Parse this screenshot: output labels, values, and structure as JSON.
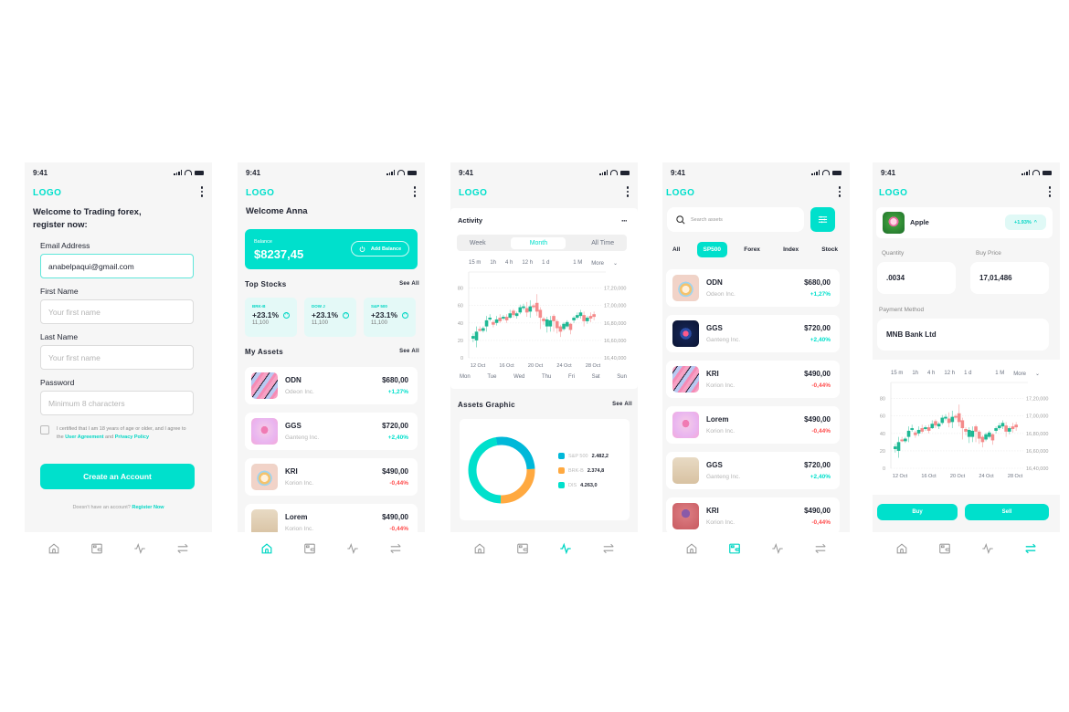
{
  "common": {
    "time": "9:41",
    "logo": "LOGO",
    "nav": [
      "home-icon",
      "wallet-icon",
      "activity-icon",
      "transfer-icon"
    ],
    "colors": {
      "accent": "#00e0cc",
      "negative": "#ff4d4d",
      "orange": "#ffa940",
      "blue": "#00b8d9"
    }
  },
  "register": {
    "title_line1": "Welcome to Trading forex,",
    "title_line2": "register now:",
    "email_label": "Email Address",
    "email_value": "anabelpaqui@gmail.com",
    "first_name_label": "First Name",
    "first_name_placeholder": "Your first name",
    "last_name_label": "Last Name",
    "last_name_placeholder": "Your first name",
    "password_label": "Password",
    "password_placeholder": "Minimum 8 characters",
    "certify_text": "I certified that I am 18 years of age or older, and I agree to the",
    "user_agreement": "User Agreement",
    "and": "and",
    "privacy_policy": "Privacy Policy",
    "create_button": "Create an Account",
    "no_account": "Doesn't have an account?",
    "register_now": "Register Now",
    "active_nav": -1
  },
  "home": {
    "welcome": "Welcome Anna",
    "balance_label": "Balance",
    "balance_value": "$8237,45",
    "add_balance": "Add Balance",
    "top_stocks_title": "Top Stocks",
    "see_all": "See All",
    "top_stocks": [
      {
        "name": "BRK-B",
        "change": "+23.1%",
        "value": "11,100"
      },
      {
        "name": "DOW J",
        "change": "+23.1%",
        "value": "11,100"
      },
      {
        "name": "S&P 500",
        "change": "+23.1%",
        "value": "11,100"
      }
    ],
    "my_assets_title": "My Assets",
    "assets": [
      {
        "ticker": "ODN",
        "company": "Odeon Inc.",
        "price": "$680,00",
        "change": "+1,27%",
        "positive": true,
        "thumb": "stripes"
      },
      {
        "ticker": "GGS",
        "company": "Ganteng Inc.",
        "price": "$720,00",
        "change": "+2,40%",
        "positive": true,
        "thumb": "pink-cloud"
      },
      {
        "ticker": "KRI",
        "company": "Korion Inc.",
        "price": "$490,00",
        "change": "-0,44%",
        "positive": false,
        "thumb": "ball"
      },
      {
        "ticker": "Lorem",
        "company": "Korion Inc.",
        "price": "$490,00",
        "change": "-0,44%",
        "positive": false,
        "thumb": "rolls"
      }
    ]
  },
  "activity": {
    "title": "Activity",
    "segments": [
      "Week",
      "Month",
      "All Time"
    ],
    "active_segment": "Month",
    "timeframes": [
      "15 m",
      "1h",
      "4 h",
      "12 h",
      "1 d",
      "1 M"
    ],
    "more": "More",
    "days": [
      "Mon",
      "Tue",
      "Wed",
      "Thu",
      "Fri",
      "Sat",
      "Sun"
    ],
    "assets_graphic_title": "Assets Graphic",
    "see_all": "See All"
  },
  "market": {
    "search_placeholder": "Search assets",
    "chips": [
      "All",
      "SP500",
      "Forex",
      "Index",
      "Stock"
    ],
    "active_chip": "SP500",
    "assets": [
      {
        "ticker": "ODN",
        "company": "Odeon Inc.",
        "price": "$680,00",
        "change": "+1,27%",
        "positive": true,
        "thumb": "ball"
      },
      {
        "ticker": "GGS",
        "company": "Ganteng Inc.",
        "price": "$720,00",
        "change": "+2,40%",
        "positive": true,
        "thumb": "dark-cube"
      },
      {
        "ticker": "KRI",
        "company": "Korion Inc.",
        "price": "$490,00",
        "change": "-0,44%",
        "positive": false,
        "thumb": "stripes"
      },
      {
        "ticker": "Lorem",
        "company": "Korion Inc.",
        "price": "$490,00",
        "change": "-0,44%",
        "positive": false,
        "thumb": "pink-cloud"
      },
      {
        "ticker": "GGS",
        "company": "Ganteng Inc.",
        "price": "$720,00",
        "change": "+2,40%",
        "positive": true,
        "thumb": "rolls"
      },
      {
        "ticker": "KRI",
        "company": "Korion Inc.",
        "price": "$490,00",
        "change": "-0,44%",
        "positive": false,
        "thumb": "tree"
      }
    ]
  },
  "trade": {
    "coin_name": "Apple",
    "coin_change": "+1.93%",
    "quantity_label": "Quantity",
    "quantity_value": ".0034",
    "buy_price_label": "Buy Price",
    "buy_price_value": "17,01,486",
    "payment_label": "Payment Method",
    "payment_value": "MNB Bank Ltd",
    "buy_button": "Buy",
    "sell_button": "Sell"
  },
  "chart_data": [
    {
      "type": "candlestick",
      "title": "Activity",
      "x_tick_labels": [
        "12 Oct",
        "16 Oct",
        "20 Oct",
        "24 Oct",
        "28 Oct"
      ],
      "y_left_ticks": [
        0,
        20,
        40,
        60,
        80
      ],
      "y_right_ticks": [
        "16,40,000",
        "16,60,000",
        "16,80,000",
        "17,00,000",
        "17,20,000"
      ],
      "ylim": [
        0,
        90
      ],
      "grid": true,
      "candles": [
        {
          "o": 22,
          "c": 25,
          "h": 28,
          "l": 18
        },
        {
          "o": 20,
          "c": 30,
          "h": 36,
          "l": 12
        },
        {
          "o": 33,
          "c": 31,
          "h": 36,
          "l": 30
        },
        {
          "o": 31,
          "c": 34,
          "h": 36,
          "l": 29
        },
        {
          "o": 36,
          "c": 43,
          "h": 48,
          "l": 30
        },
        {
          "o": 44,
          "c": 46,
          "h": 50,
          "l": 42
        },
        {
          "o": 41,
          "c": 38,
          "h": 43,
          "l": 35
        },
        {
          "o": 40,
          "c": 44,
          "h": 48,
          "l": 37
        },
        {
          "o": 46,
          "c": 42,
          "h": 50,
          "l": 40
        },
        {
          "o": 45,
          "c": 47,
          "h": 49,
          "l": 43
        },
        {
          "o": 47,
          "c": 43,
          "h": 50,
          "l": 40
        },
        {
          "o": 46,
          "c": 51,
          "h": 55,
          "l": 45
        },
        {
          "o": 54,
          "c": 49,
          "h": 56,
          "l": 46
        },
        {
          "o": 48,
          "c": 51,
          "h": 53,
          "l": 45
        },
        {
          "o": 52,
          "c": 58,
          "h": 61,
          "l": 50
        },
        {
          "o": 57,
          "c": 59,
          "h": 62,
          "l": 55
        },
        {
          "o": 57,
          "c": 52,
          "h": 64,
          "l": 47
        },
        {
          "o": 53,
          "c": 59,
          "h": 66,
          "l": 46
        },
        {
          "o": 60,
          "c": 58,
          "h": 62,
          "l": 56
        },
        {
          "o": 63,
          "c": 53,
          "h": 73,
          "l": 48
        },
        {
          "o": 55,
          "c": 46,
          "h": 58,
          "l": 33
        },
        {
          "o": 45,
          "c": 42,
          "h": 47,
          "l": 38
        },
        {
          "o": 36,
          "c": 44,
          "h": 47,
          "l": 29
        },
        {
          "o": 36,
          "c": 43,
          "h": 48,
          "l": 30
        },
        {
          "o": 48,
          "c": 42,
          "h": 50,
          "l": 30
        },
        {
          "o": 42,
          "c": 34,
          "h": 44,
          "l": 28
        },
        {
          "o": 36,
          "c": 30,
          "h": 38,
          "l": 24
        },
        {
          "o": 33,
          "c": 39,
          "h": 41,
          "l": 31
        },
        {
          "o": 36,
          "c": 41,
          "h": 43,
          "l": 34
        },
        {
          "o": 39,
          "c": 32,
          "h": 40,
          "l": 27
        },
        {
          "o": 43,
          "c": 46,
          "h": 48,
          "l": 40
        },
        {
          "o": 46,
          "c": 49,
          "h": 52,
          "l": 44
        },
        {
          "o": 48,
          "c": 52,
          "h": 55,
          "l": 45
        },
        {
          "o": 49,
          "c": 42,
          "h": 53,
          "l": 36
        },
        {
          "o": 42,
          "c": 46,
          "h": 48,
          "l": 39
        },
        {
          "o": 48,
          "c": 45,
          "h": 52,
          "l": 41
        },
        {
          "o": 50,
          "c": 47,
          "h": 53,
          "l": 43
        }
      ]
    },
    {
      "type": "pie",
      "title": "Assets Graphic",
      "labels": [
        "S&P 500",
        "BRK-B",
        "DIS"
      ],
      "values": [
        2482.2,
        2374.8,
        4263.0
      ],
      "value_labels": [
        "2.482,2",
        "2.374,8",
        "4.263,0"
      ],
      "colors": [
        "#00b8d9",
        "#ffa940",
        "#00e0cc"
      ],
      "legend": "right"
    }
  ]
}
